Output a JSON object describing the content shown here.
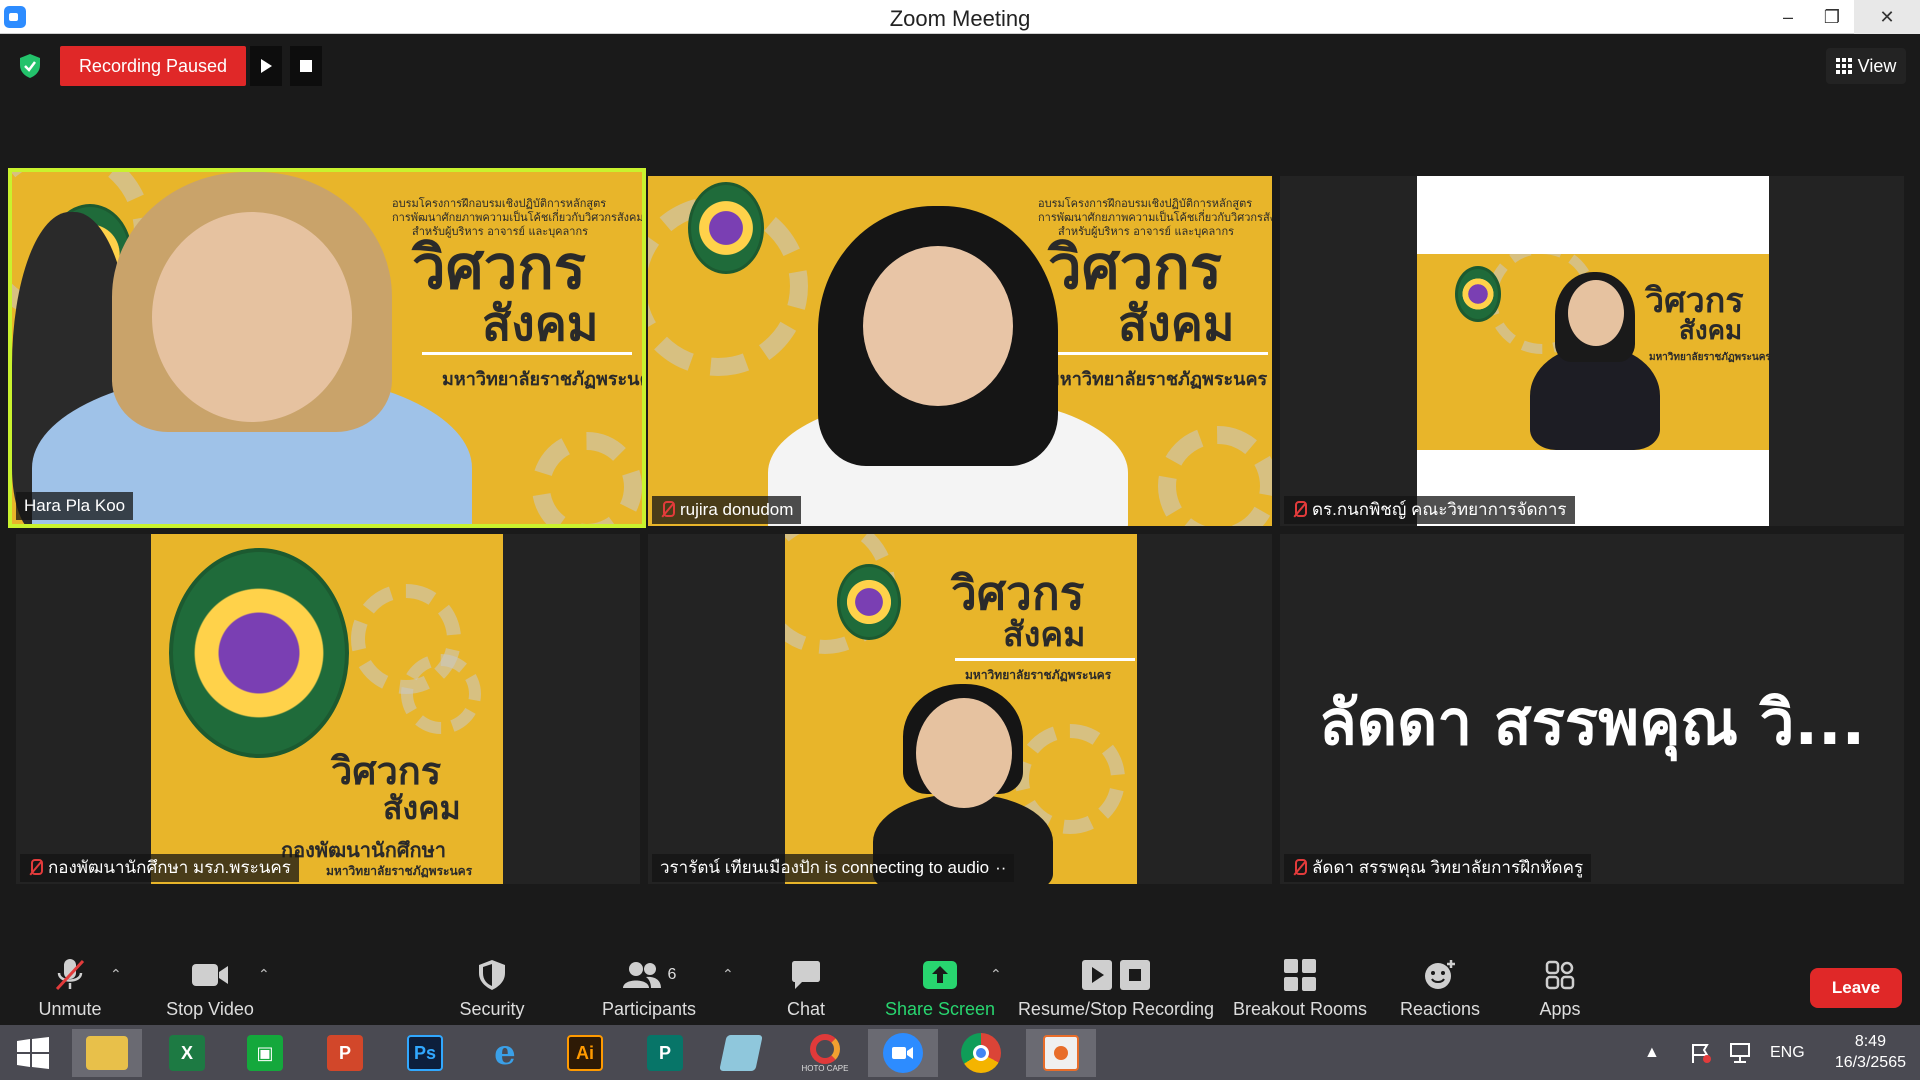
{
  "window": {
    "title": "Zoom Meeting"
  },
  "recording": {
    "status": "Recording Paused"
  },
  "view": {
    "label": "View"
  },
  "tiles": [
    {
      "name": "Hara Pla Koo",
      "muted": false,
      "active": true
    },
    {
      "name": "rujira donudom",
      "muted": true
    },
    {
      "name": "ดร.กนกพิชญ์ คณะวิทยาการจัดการ",
      "muted": true
    },
    {
      "name": "กองพัฒนานักศึกษา มรภ.พระนคร",
      "muted": true
    },
    {
      "name": "วรารัตน์ เทียนเมืองปัก is connecting to audio",
      "status_indicator": "··"
    },
    {
      "name": "ลัดดา สรรพคุณ วิทยาลัยการฝึกหัดครู",
      "muted": true,
      "display_name": "ลัดดา สรรพคุณ วิ..."
    }
  ],
  "slide": {
    "header_line1": "อบรมโครงการฝึกอบรมเชิงปฏิบัติการหลักสูตร",
    "header_line2": "การพัฒนาศักยภาพความเป็นโค้ชเกี่ยวกับวิศวกรสังคม",
    "header_line3": "สำหรับผู้บริหาร อาจารย์ และบุคลากร",
    "title_line1": "วิศวกร",
    "title_line2": "สังคม",
    "university": "มหาวิทยาลัยราชภัฏพระนคร",
    "division": "กองพัฒนานักศึกษา"
  },
  "toolbar": {
    "unmute": "Unmute",
    "stop_video": "Stop Video",
    "security": "Security",
    "participants": "Participants",
    "participants_count": "6",
    "chat": "Chat",
    "share_screen": "Share Screen",
    "recording": "Resume/Stop Recording",
    "breakout": "Breakout Rooms",
    "reactions": "Reactions",
    "apps": "Apps",
    "leave": "Leave"
  },
  "taskbar": {
    "apps": [
      "windows-start",
      "file-explorer",
      "excel",
      "store",
      "powerpoint",
      "photoshop",
      "internet-explorer",
      "illustrator",
      "publisher",
      "notepad",
      "photoscape",
      "zoom",
      "chrome",
      "photos"
    ],
    "photoscape_label": "HOTO CAPE",
    "language": "ENG",
    "time": "8:49",
    "date": "16/3/2565"
  },
  "colors": {
    "recording_red": "#e02828",
    "active_speaker": "#c9f22e",
    "share_green": "#28d56f",
    "slide_yellow": "#e8b52a"
  }
}
